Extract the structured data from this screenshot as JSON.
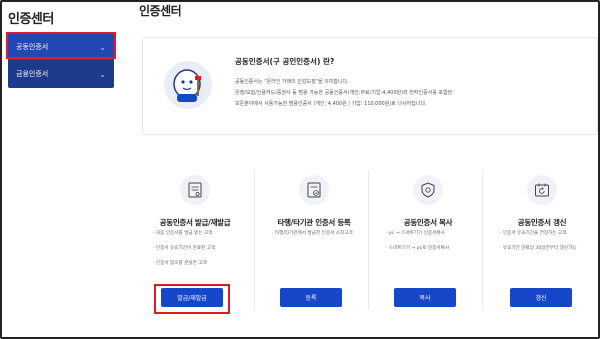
{
  "sidebar": {
    "title": "인증센터",
    "items": [
      {
        "label": "공동인증서"
      },
      {
        "label": "금융인증서"
      }
    ]
  },
  "page": {
    "title": "인증센터"
  },
  "info": {
    "heading": "공동인증서(구 공인인증서) 란?",
    "lines": [
      "공동인증서는 \"온라인 거래의 인감도장\"을 의미합니다.",
      "은행/보험/신용카드/증권사 등 범용 가능한 공동인증서(개인:무료/기업:4,400원)와 전자인증서를 포함한",
      "모든분야에서 사용가능한 범용인증서 (개인: 4,400원 / 기업: 110,000원)로 나뉘어집니다."
    ]
  },
  "cards": [
    {
      "title": "공동인증서 발급/재발급",
      "bullets": [
        "처음 인증서를 발급 받는 고객",
        "인증서 유효기간이 만료된 고객",
        "인증서 암호를 분실한 고객"
      ],
      "button": "발급/재발급"
    },
    {
      "title": "타행/타기관 인증서 등록",
      "bullets": [
        "타행/타기관에서 발급한 인증서 소지고객"
      ],
      "button": "등록"
    },
    {
      "title": "공동인증서 복사",
      "bullets": [
        "pc → 스마트기기 인증서복사",
        "스마트기기 → pc로 인증서복사"
      ],
      "button": "복사"
    },
    {
      "title": "공동인증서 갱신",
      "bullets": [
        "인증서 유효기간을 연장하는 고객",
        "유효기간 만료일 30일전부터 갱신가능"
      ],
      "button": "갱신"
    }
  ],
  "colors": {
    "primary": "#1747c9",
    "sidebar": "#1e3a8a",
    "highlight": "#e01b24"
  }
}
